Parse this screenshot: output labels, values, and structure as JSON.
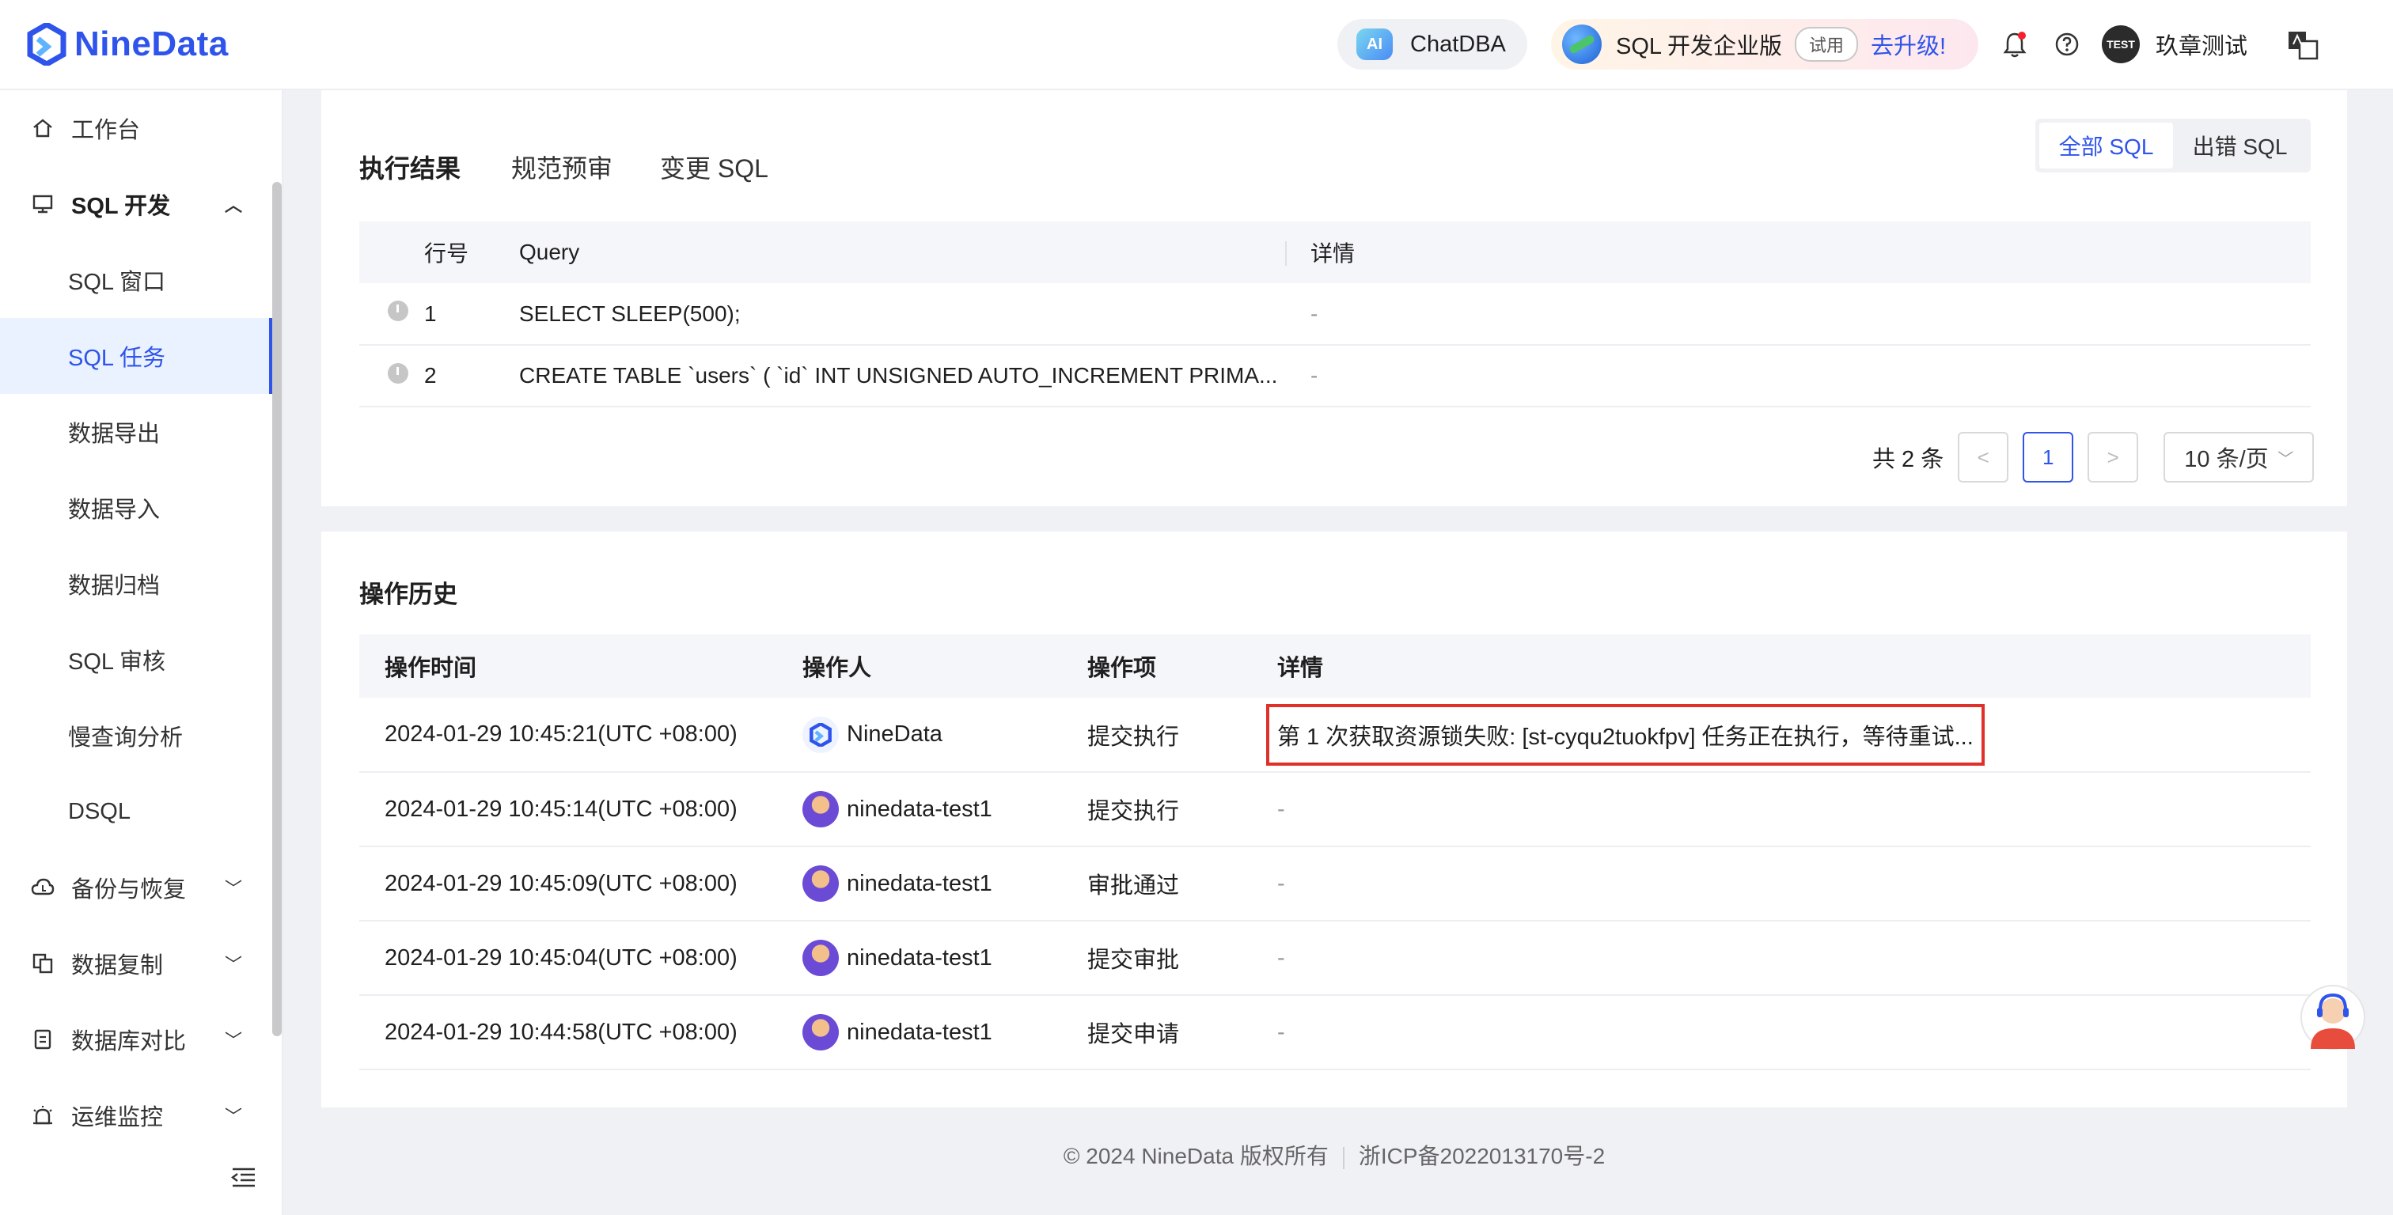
{
  "header": {
    "logo_text": "NineData",
    "chatdba_badge": "AI",
    "chatdba_label": "ChatDBA",
    "enterprise_label": "SQL 开发企业版",
    "trial_label": "试用",
    "upgrade_label": "去升级!",
    "user_badge": "TEST",
    "user_name": "玖章测试"
  },
  "sidebar": {
    "items": [
      {
        "label": "工作台",
        "icon": "home-icon"
      },
      {
        "label": "SQL 开发",
        "icon": "monitor-icon",
        "expanded": true
      },
      {
        "label": "SQL 窗口"
      },
      {
        "label": "SQL 任务",
        "active": true
      },
      {
        "label": "数据导出"
      },
      {
        "label": "数据导入"
      },
      {
        "label": "数据归档"
      },
      {
        "label": "SQL 审核"
      },
      {
        "label": "慢查询分析"
      },
      {
        "label": "DSQL"
      },
      {
        "label": "备份与恢复",
        "icon": "cloud-backup-icon"
      },
      {
        "label": "数据复制",
        "icon": "copy-icon"
      },
      {
        "label": "数据库对比",
        "icon": "compare-icon"
      },
      {
        "label": "运维监控",
        "icon": "alarm-icon"
      }
    ]
  },
  "result_panel": {
    "tabs": [
      "执行结果",
      "规范预审",
      "变更 SQL"
    ],
    "filter": [
      "全部 SQL",
      "出错 SQL"
    ],
    "columns": [
      "行号",
      "Query",
      "详情"
    ],
    "rows": [
      {
        "no": "1",
        "query": "SELECT SLEEP(500);",
        "detail": "-"
      },
      {
        "no": "2",
        "query": "CREATE TABLE `users` ( `id` INT UNSIGNED AUTO_INCREMENT PRIMA...",
        "detail": "-"
      }
    ],
    "total": "共 2 条",
    "prev": "<",
    "current_page": "1",
    "next": ">",
    "page_size": "10 条/页"
  },
  "history_panel": {
    "title": "操作历史",
    "columns": [
      "操作时间",
      "操作人",
      "操作项",
      "详情"
    ],
    "rows": [
      {
        "time": "2024-01-29 10:45:21(UTC +08:00)",
        "operator": "NineData",
        "action": "提交执行",
        "detail": "第 1 次获取资源锁失败: [st-cyqu2tuokfpv] 任务正在执行，等待重试..."
      },
      {
        "time": "2024-01-29 10:45:14(UTC +08:00)",
        "operator": "ninedata-test1",
        "action": "提交执行",
        "detail": "-"
      },
      {
        "time": "2024-01-29 10:45:09(UTC +08:00)",
        "operator": "ninedata-test1",
        "action": "审批通过",
        "detail": "-"
      },
      {
        "time": "2024-01-29 10:45:04(UTC +08:00)",
        "operator": "ninedata-test1",
        "action": "提交审批",
        "detail": "-"
      },
      {
        "time": "2024-01-29 10:44:58(UTC +08:00)",
        "operator": "ninedata-test1",
        "action": "提交申请",
        "detail": "-"
      }
    ]
  },
  "footer": {
    "copyright": "© 2024 NineData 版权所有",
    "icp": "浙ICP备2022013170号-2"
  },
  "colors": {
    "accent": "#2f54eb",
    "highlight_border": "#e0302a"
  }
}
